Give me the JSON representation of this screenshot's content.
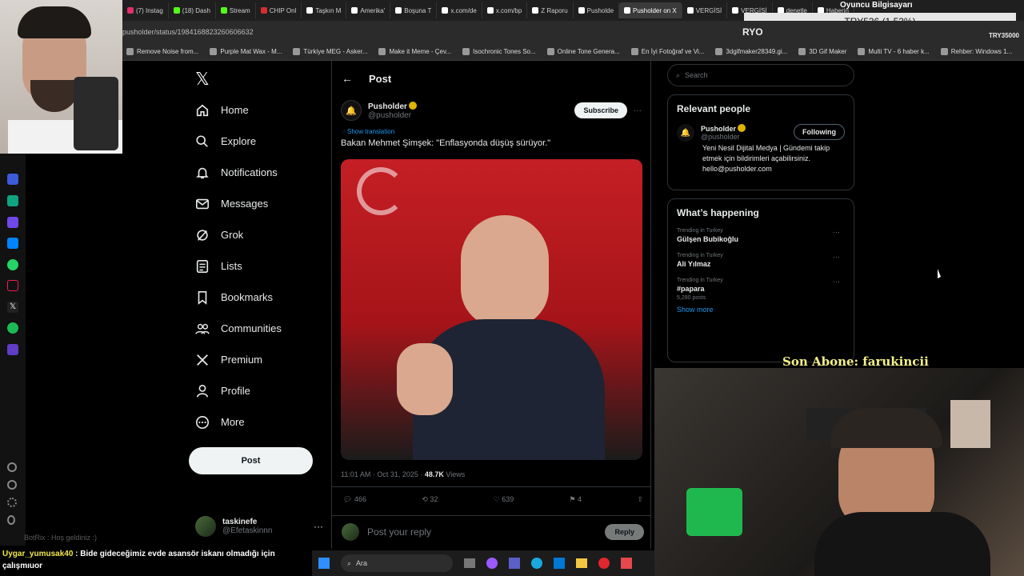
{
  "browser": {
    "tabs": [
      {
        "label": "(7) Instag",
        "color": "#e1306c"
      },
      {
        "label": "(18) Dash",
        "color": "#53fc18"
      },
      {
        "label": "Stream",
        "color": "#53fc18"
      },
      {
        "label": "CHIP Onl",
        "color": "#d32f2f"
      },
      {
        "label": "Taşkın M",
        "color": "#ffffff"
      },
      {
        "label": "Amerika'",
        "color": "#ffffff"
      },
      {
        "label": "Boşuna T",
        "color": "#ffffff"
      },
      {
        "label": "x.com/de",
        "color": "#ffffff"
      },
      {
        "label": "x.com/bp",
        "color": "#ffffff"
      },
      {
        "label": "Z Raporu",
        "color": "#ffffff"
      },
      {
        "label": "Pusholde",
        "color": "#ffffff"
      },
      {
        "label": "Pusholder on X",
        "color": "#ffffff",
        "active": true
      },
      {
        "label": "VERGİSİ",
        "color": "#ffffff"
      },
      {
        "label": "VERGİSİ",
        "color": "#ffffff"
      },
      {
        "label": "denetle",
        "color": "#ffffff"
      },
      {
        "label": "Haberin",
        "color": "#ffffff"
      }
    ],
    "url": "pusholder/status/1984168823260606632",
    "bookmarks": [
      "Remove Noise from...",
      "Purple Mat Wax - M...",
      "Türkiye MEG - Asker...",
      "Make it Meme - Çev...",
      "Isochronic Tones So...",
      "Online Tone Genera...",
      "En İyi Fotoğraf ve Vi...",
      "3dgifmaker28349.gi...",
      "3D Gif Maker",
      "Multi TV - 6 haber k...",
      "Rehber: Windows 1..."
    ]
  },
  "overlay": {
    "stream_title": "Oyuncu Bilgisayarı",
    "price_ticker": "TRY536 (1.53%)",
    "ticker_left": "RYO",
    "ticker_right": "TRY35000",
    "last_sub": "Son Abone: farukincii",
    "chat": [
      {
        "user": "BotRix",
        "text": "Hoş geldiniz :)"
      },
      {
        "user": "Uygar_yumusak40",
        "text": "Bide gideceğimiz evde asansör iskanı olmadığı için çalışmıuor"
      }
    ]
  },
  "nav": {
    "items": [
      {
        "label": "Home",
        "icon": "home-icon"
      },
      {
        "label": "Explore",
        "icon": "search-icon"
      },
      {
        "label": "Notifications",
        "icon": "bell-icon"
      },
      {
        "label": "Messages",
        "icon": "envelope-icon"
      },
      {
        "label": "Grok",
        "icon": "grok-icon"
      },
      {
        "label": "Lists",
        "icon": "list-icon"
      },
      {
        "label": "Bookmarks",
        "icon": "bookmark-icon"
      },
      {
        "label": "Communities",
        "icon": "communities-icon"
      },
      {
        "label": "Premium",
        "icon": "x-logo-icon"
      },
      {
        "label": "Profile",
        "icon": "person-icon"
      },
      {
        "label": "More",
        "icon": "more-circle-icon"
      }
    ],
    "post_button": "Post",
    "account_name": "taskinefe",
    "account_handle": "@Efetaskinnn"
  },
  "post": {
    "header": "Post",
    "author_name": "Pusholder",
    "author_handle": "@pusholder",
    "subscribe": "Subscribe",
    "show_translation": "Show translation",
    "text": "Bakan Mehmet Şimşek: \"Enflasyonda düşüş sürüyor.\"",
    "timestamp": "11:01 AM · Oct 31, 2025 · ",
    "views_count": "48.7K",
    "views_label": " Views",
    "replies": "466",
    "reposts": "32",
    "likes": "639",
    "bookmarks": "4",
    "reply_placeholder": "Post your reply",
    "reply_button": "Reply"
  },
  "sidebar": {
    "search_placeholder": "Search",
    "relevant_title": "Relevant people",
    "person_name": "Pusholder",
    "person_handle": "@pusholder",
    "follow_button": "Following",
    "person_bio": "Yeni Nesil Dijital Medya | Gündemi takip etmek için bildirimleri açabilirsiniz. hello@pusholder.com",
    "trends_title": "What’s happening",
    "trends": [
      {
        "context": "Trending in Turkey",
        "name": "Gülşen Bubikoğlu",
        "posts": ""
      },
      {
        "context": "Trending in Turkey",
        "name": "Ali Yılmaz",
        "posts": ""
      },
      {
        "context": "Trending in Turkey",
        "name": "#papara",
        "posts": "5,280 posts"
      }
    ],
    "show_more": "Show more"
  },
  "taskbar": {
    "search_label": "Ara"
  }
}
